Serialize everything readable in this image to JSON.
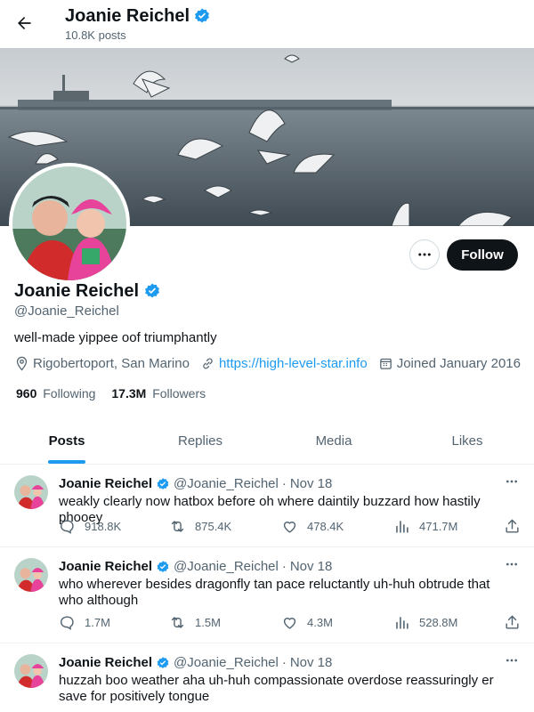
{
  "header": {
    "title": "Joanie Reichel",
    "posts_count": "10.8K posts"
  },
  "profile": {
    "name": "Joanie Reichel",
    "handle": "@Joanie_Reichel",
    "bio": "well-made yippee oof triumphantly",
    "location": "Rigobertoport, San Marino",
    "website": "https://high-level-star.info",
    "joined": "Joined January 2016",
    "following_count": "960",
    "following_label": "Following",
    "followers_count": "17.3M",
    "followers_label": "Followers",
    "follow_button": "Follow",
    "verified_color": "#1d9bf0"
  },
  "tabs": [
    {
      "label": "Posts",
      "active": true
    },
    {
      "label": "Replies",
      "active": false
    },
    {
      "label": "Media",
      "active": false
    },
    {
      "label": "Likes",
      "active": false
    }
  ],
  "tweets": [
    {
      "name": "Joanie Reichel",
      "handle": "@Joanie_Reichel",
      "date": "Nov 18",
      "text": "weakly clearly now hatbox before oh where daintily buzzard how hastily phooey",
      "replies": "918.8K",
      "reposts": "875.4K",
      "likes": "478.4K",
      "views": "471.7M"
    },
    {
      "name": "Joanie Reichel",
      "handle": "@Joanie_Reichel",
      "date": "Nov 18",
      "text": "who wherever besides dragonfly tan pace reluctantly uh-huh obtrude that who although",
      "replies": "1.7M",
      "reposts": "1.5M",
      "likes": "4.3M",
      "views": "528.8M"
    },
    {
      "name": "Joanie Reichel",
      "handle": "@Joanie_Reichel",
      "date": "Nov 18",
      "text": "huzzah boo weather aha uh-huh compassionate overdose reassuringly er save for positively tongue",
      "replies": "",
      "reposts": "",
      "likes": "",
      "views": ""
    }
  ]
}
